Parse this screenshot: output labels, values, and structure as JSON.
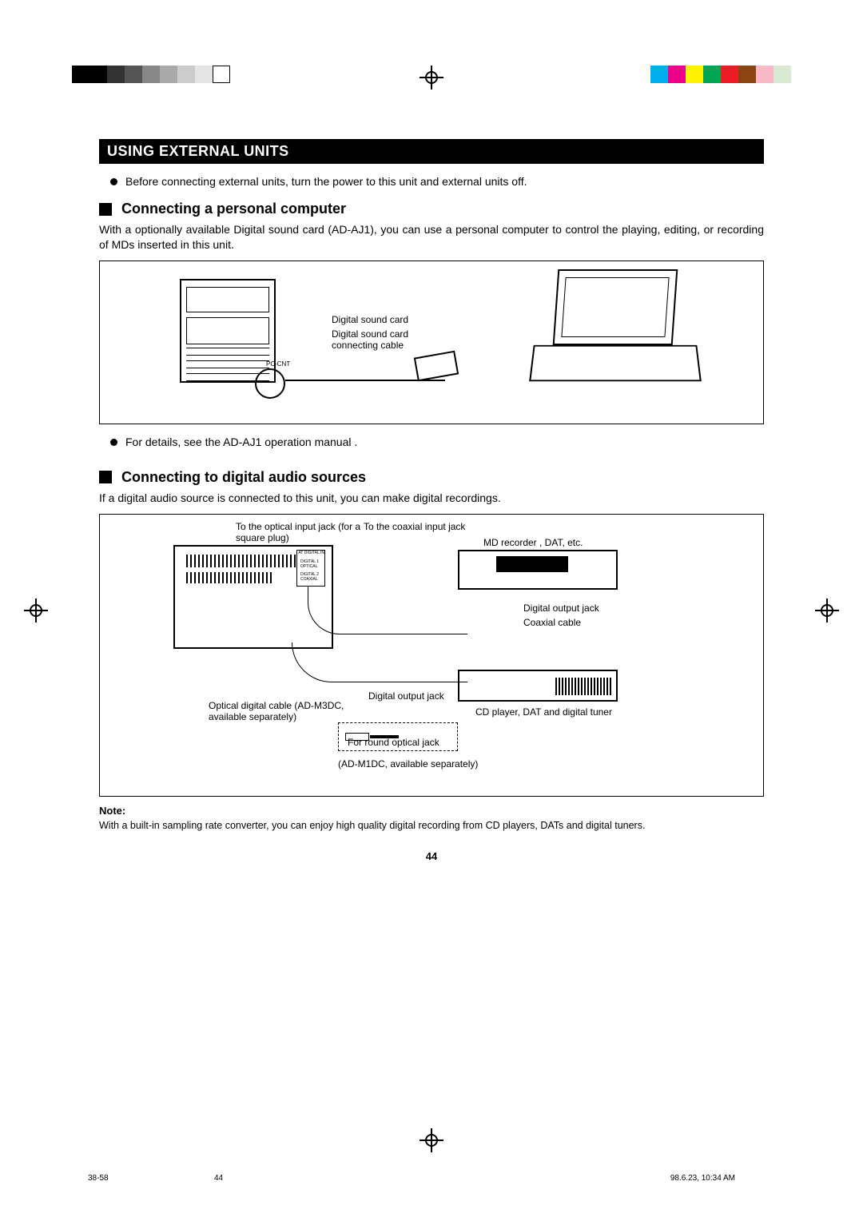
{
  "header_bar": "USING EXTERNAL UNITS",
  "intro_bullet": "Before connecting external units, turn the power to this unit and external units off.",
  "section1": {
    "heading": "Connecting a personal computer",
    "paragraph": "With a optionally available Digital sound card (AD-AJ1), you can use a personal computer to control the playing, editing, or recording of MDs inserted in this unit.",
    "figure": {
      "label_card": "Digital sound card",
      "label_cable": "Digital sound  card connecting cable",
      "label_port": "PC-CNT"
    },
    "followup_bullet": "For details, see the AD-AJ1 operation manual ."
  },
  "section2": {
    "heading": "Connecting to digital audio sources",
    "paragraph": "If a digital audio source is connected to this unit, you can make digital recordings.",
    "figure": {
      "label_to_optical": "To the optical input jack (for a square plug)",
      "label_to_coaxial": "To the coaxial input jack",
      "label_md_recorder": "MD recorder , DAT, etc.",
      "label_digital_out1": "Digital output jack",
      "label_coax_cable": "Coaxial cable",
      "label_optical_cable": "Optical digital cable (AD-M3DC, available separately)",
      "label_digital_out2": "Digital output jack",
      "label_round_optical": "For round optical jack",
      "label_adm1dc": "(AD-M1DC, available separately)",
      "label_cd_player": "CD player, DAT and digital tuner",
      "panel_text1": "AT DIGITAL IN",
      "panel_text2": "DIGITAL 1 OPTICAL",
      "panel_text3": "DIGITAL 2 COAXIAL"
    },
    "note_heading": "Note:",
    "note_text": "With a built-in sampling rate converter, you can enjoy high quality digital recording from CD players, DATs and digital tuners."
  },
  "page_number": "44",
  "footer": {
    "left": "38-58",
    "mid": "44",
    "right": "98.6.23, 10:34 AM"
  }
}
